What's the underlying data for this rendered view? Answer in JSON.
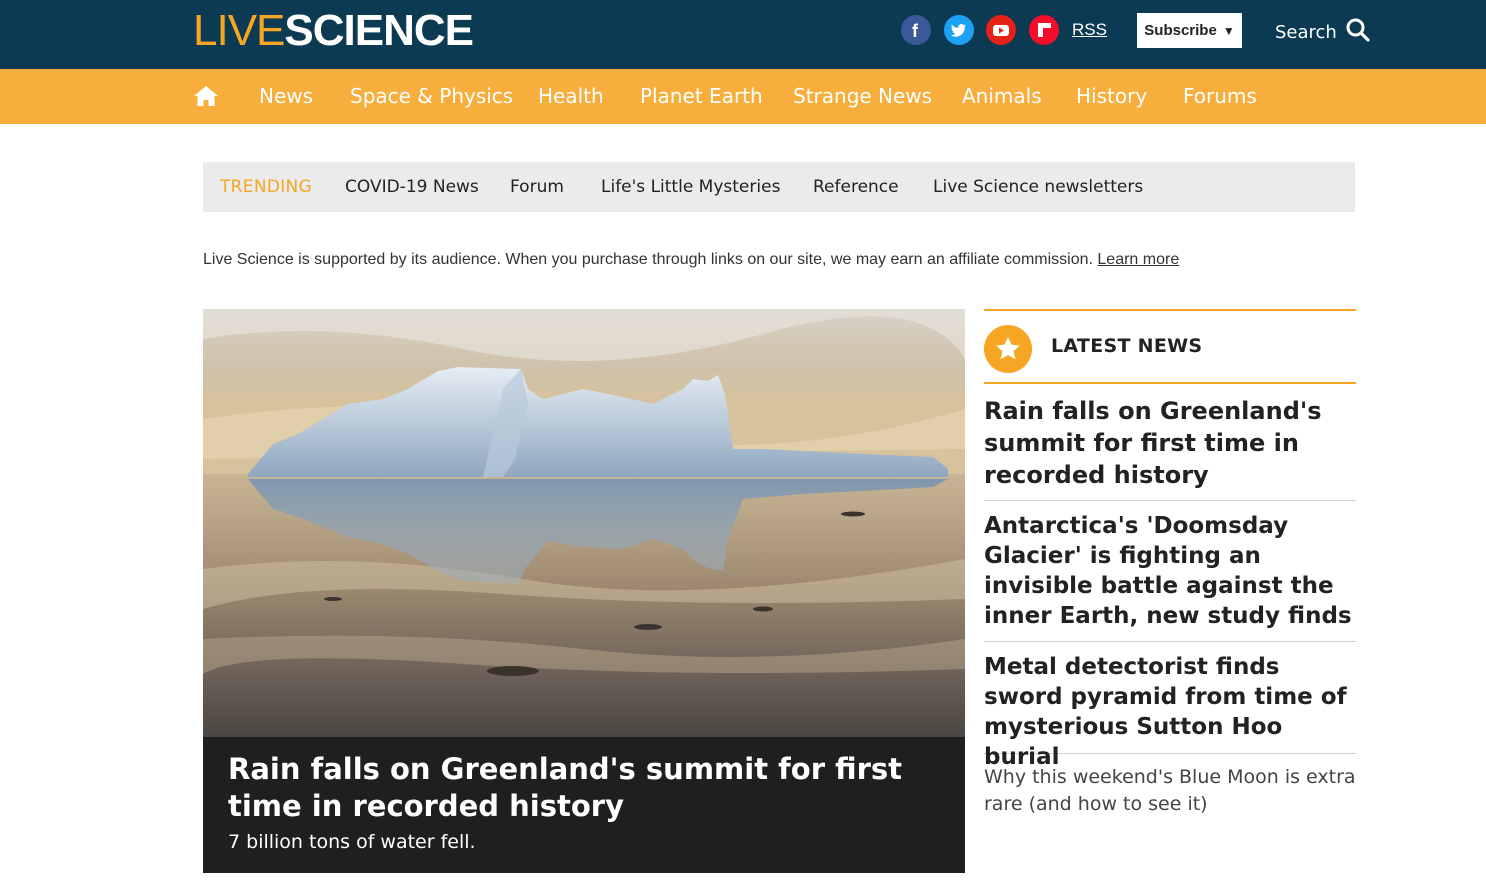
{
  "header": {
    "logo_part1": "LIVE",
    "logo_part2": "SCIENCE",
    "social": [
      "facebook-icon",
      "twitter-icon",
      "youtube-icon",
      "flipboard-icon"
    ],
    "rss_label": "RSS",
    "subscribe_label": "Subscribe",
    "search_label": "Search"
  },
  "colors": {
    "header_bg": "#0b3a52",
    "nav_bg": "#f7ae3c",
    "accent": "#f6a623"
  },
  "nav": {
    "home_icon": "home-icon",
    "items": [
      "News",
      "Space & Physics",
      "Health",
      "Planet Earth",
      "Strange News",
      "Animals",
      "History",
      "Forums"
    ]
  },
  "trending": {
    "label": "TRENDING",
    "items": [
      "COVID-19 News",
      "Forum",
      "Life's Little Mysteries",
      "Reference",
      "Live Science newsletters"
    ]
  },
  "affiliate": {
    "text": "Live Science is supported by its audience. When you purchase through links on our site, we may earn an affiliate commission. ",
    "link": "Learn more"
  },
  "hero": {
    "title": "Rain falls on Greenland's summit for first time in recorded history",
    "subtitle": "7 billion tons of water fell."
  },
  "latest": {
    "heading": "LATEST NEWS",
    "items": [
      "Rain falls on Greenland's summit for first time in recorded history",
      "Antarctica's 'Doomsday Glacier' is fighting an invisible battle against the inner Earth, new study finds",
      "Metal detectorist finds sword pyramid from time of mysterious Sutton Hoo burial",
      "Why this weekend's Blue Moon is extra rare (and how to see it)"
    ]
  }
}
